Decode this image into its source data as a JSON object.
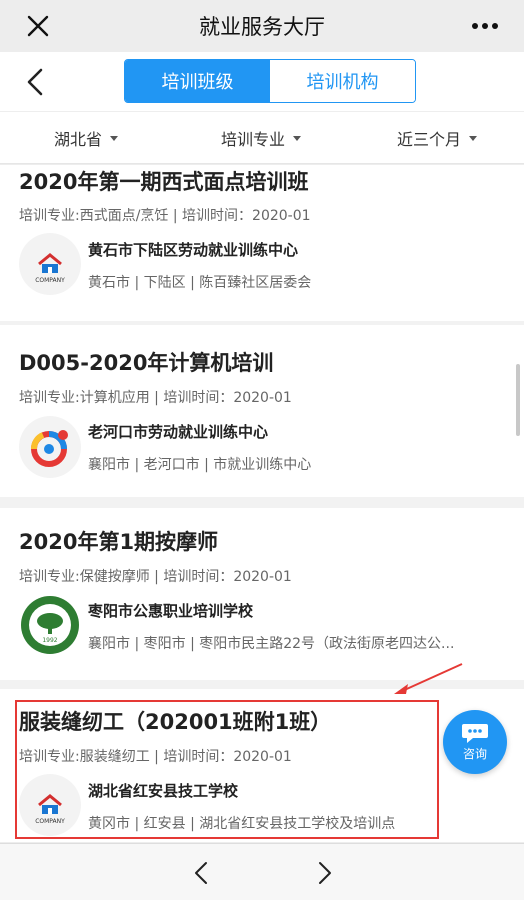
{
  "window": {
    "title": "就业服务大厅"
  },
  "tabs": [
    {
      "label": "培训班级",
      "active": true
    },
    {
      "label": "培训机构",
      "active": false
    }
  ],
  "filters": [
    {
      "label": "湖北省"
    },
    {
      "label": "培训专业"
    },
    {
      "label": "近三个月"
    }
  ],
  "cards": [
    {
      "title": "2020年第一期西式面点培训班",
      "meta": "培训专业:西式面点/烹饪 | 培训时间：2020-01",
      "org": "黄石市下陆区劳动就业训练中心",
      "location": "黄石市 | 下陆区 | 陈百臻社区居委会",
      "logo": "company-house-logo",
      "logo_text": "COMPANY"
    },
    {
      "title": "D005-2020年计算机培训",
      "meta": "培训专业:计算机应用 | 培训时间：2020-01",
      "org": "老河口市劳动就业训练中心",
      "location": "襄阳市 | 老河口市 | 市就业训练中心",
      "logo": "swirl-logo"
    },
    {
      "title": "2020年第1期按摩师",
      "meta": "培训专业:保健按摩师 | 培训时间：2020-01",
      "org": "枣阳市公惠职业培训学校",
      "location": "襄阳市 | 枣阳市 | 枣阳市民主路22号（政法街原老四达公...",
      "logo": "tree-seal-logo",
      "logo_text": "1992"
    },
    {
      "title": "服装缝纫工（202001班附1班）",
      "meta": "培训专业:服装缝纫工 | 培训时间：2020-01",
      "org": "湖北省红安县技工学校",
      "location": "黄冈市 | 红安县 | 湖北省红安县技工学校及培训点",
      "logo": "company-house-logo",
      "logo_text": "COMPANY"
    }
  ],
  "consult": {
    "label": "咨询"
  },
  "colors": {
    "accent": "#2196f3",
    "highlight": "#e53935"
  },
  "icons": {
    "close": "close-icon",
    "more": "more-icon",
    "back": "back-icon",
    "prev": "chevron-left-icon",
    "next": "chevron-right-icon"
  }
}
